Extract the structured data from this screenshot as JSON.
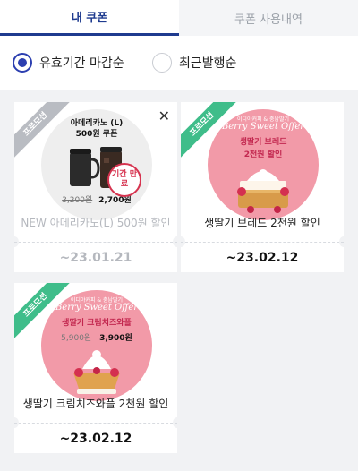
{
  "tabs": [
    {
      "label": "내 쿠폰"
    },
    {
      "label": "쿠폰 사용내역"
    }
  ],
  "sort": {
    "options": [
      {
        "label": "유효기간 마감순",
        "selected": true
      },
      {
        "label": "최근발행순",
        "selected": false
      }
    ]
  },
  "coupons": [
    {
      "ribbon": "프로모션",
      "status": "expired",
      "image_title_line1": "아메리카노 (L)",
      "image_title_line2": "500원 쿠폰",
      "old_price": "3,200원",
      "new_price": "2,700원",
      "expired_badge": "기간 만료",
      "title": "NEW 아메리카노(L) 500원 할인",
      "expiry": "~23.01.21"
    },
    {
      "ribbon": "프로모션",
      "status": "active",
      "image_small": "이디야커피 & 충남딸기",
      "image_brand": "Berry Sweet Offer",
      "image_text_line1": "생딸기 브레드",
      "image_text_line2": "2천원 할인",
      "title": "생딸기 브레드 2천원 할인",
      "expiry": "~23.02.12"
    },
    {
      "ribbon": "프로모션",
      "status": "active",
      "image_small": "이디야커피 & 충남딸기",
      "image_brand": "Berry Sweet Offer",
      "image_text_line1": "생딸기 크림치즈와플",
      "old_price": "5,900원",
      "new_price": "3,900원",
      "title": "생딸기 크림치즈와플 2천원 할인",
      "expiry": "~23.02.12"
    }
  ],
  "colors": {
    "accent": "#1f3b8f",
    "ribbon_green": "#3fbd8a",
    "ribbon_gray": "#b9bcc2",
    "expired_red": "#d6334f",
    "pink_bg": "#f29aa8"
  }
}
